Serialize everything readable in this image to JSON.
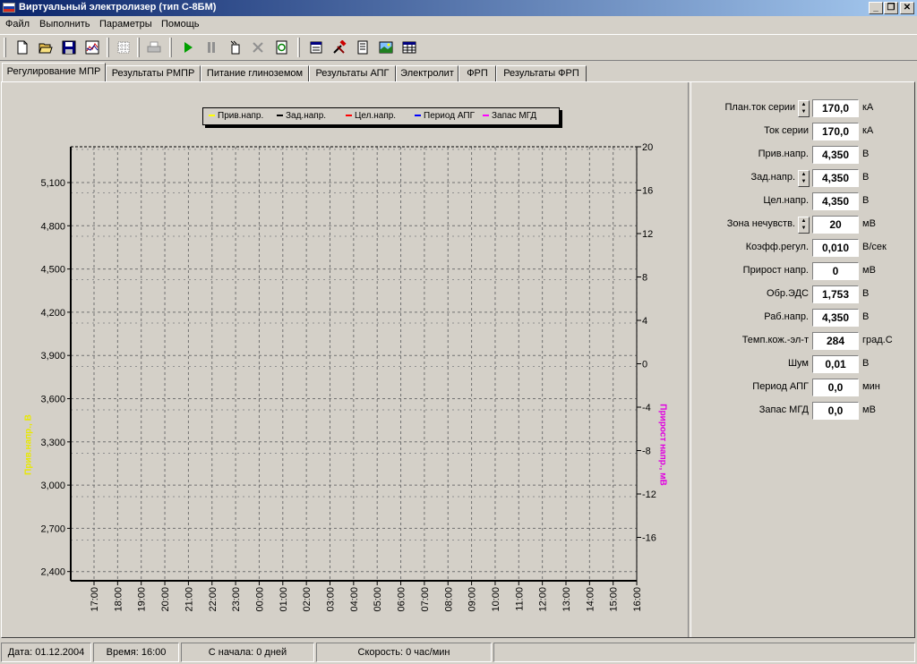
{
  "window": {
    "title": "Виртуальный электролизер (тип С-8БМ)",
    "controls": [
      "_",
      "❐",
      "✕"
    ]
  },
  "menu": [
    "Файл",
    "Выполнить",
    "Параметры",
    "Помощь"
  ],
  "toolbar": {
    "buttons": [
      "new-icon",
      "open-icon",
      "save-icon",
      "chart-icon",
      "grid-icon",
      "print-icon",
      "play-icon",
      "pause-icon",
      "step-icon",
      "stop-icon",
      "refresh-icon",
      "calc-icon",
      "tools-icon",
      "document-icon",
      "image-icon",
      "table-icon"
    ]
  },
  "tabs": [
    "Регулирование МПР",
    "Результаты РМПР",
    "Питание глиноземом",
    "Результаты АПГ",
    "Электролит",
    "ФРП",
    "Результаты ФРП"
  ],
  "chart_data": {
    "type": "line",
    "legend": [
      {
        "name": "Прив.напр.",
        "color": "#ffff00"
      },
      {
        "name": "Зад.напр.",
        "color": "#000000"
      },
      {
        "name": "Цел.напр.",
        "color": "#ff0000"
      },
      {
        "name": "Период АПГ",
        "color": "#0000ff"
      },
      {
        "name": "Запас МГД",
        "color": "#ff00ff"
      }
    ],
    "legend_position": "top",
    "ylabel_left": "Прив.напр., В",
    "ylabel_right": "Прирост напр., мВ",
    "yticks_left": [
      "5,100",
      "4,800",
      "4,500",
      "4,200",
      "3,900",
      "3,600",
      "3,300",
      "3,000",
      "2,700",
      "2,400"
    ],
    "yticks_right": [
      "20",
      "16",
      "12",
      "8",
      "4",
      "0",
      "-4",
      "-8",
      "-12",
      "-16"
    ],
    "xticks": [
      "17:00",
      "18:00",
      "19:00",
      "20:00",
      "21:00",
      "22:00",
      "23:00",
      "00:00",
      "01:00",
      "02:00",
      "03:00",
      "04:00",
      "05:00",
      "06:00",
      "07:00",
      "08:00",
      "09:00",
      "10:00",
      "11:00",
      "12:00",
      "13:00",
      "14:00",
      "15:00",
      "16:00"
    ],
    "grid": true,
    "series": []
  },
  "params": [
    {
      "label": "План.ток серии",
      "value": "170,0",
      "unit": "кА",
      "spin": true
    },
    {
      "label": "Ток серии",
      "value": "170,0",
      "unit": "кА",
      "spin": false
    },
    {
      "label": "Прив.напр.",
      "value": "4,350",
      "unit": "В",
      "spin": false
    },
    {
      "label": "Зад.напр.",
      "value": "4,350",
      "unit": "В",
      "spin": true
    },
    {
      "label": "Цел.напр.",
      "value": "4,350",
      "unit": "В",
      "spin": false
    },
    {
      "label": "Зона нечувств.",
      "value": "20",
      "unit": "мВ",
      "spin": true
    },
    {
      "label": "Коэфф.регул.",
      "value": "0,010",
      "unit": "В/сек",
      "spin": false
    },
    {
      "label": "Прирост напр.",
      "value": "0",
      "unit": "мВ",
      "spin": false
    },
    {
      "label": "Обр.ЭДС",
      "value": "1,753",
      "unit": "В",
      "spin": false
    },
    {
      "label": "Раб.напр.",
      "value": "4,350",
      "unit": "В",
      "spin": false
    },
    {
      "label": "Темп.кож.-эл-т",
      "value": "284",
      "unit": "град.С",
      "spin": false
    },
    {
      "label": "Шум",
      "value": "0,01",
      "unit": "В",
      "spin": false
    },
    {
      "label": "Период АПГ",
      "value": "0,0",
      "unit": "мин",
      "spin": false
    },
    {
      "label": "Запас МГД",
      "value": "0,0",
      "unit": "мВ",
      "spin": false
    }
  ],
  "status": {
    "date": "Дата: 01.12.2004",
    "time": "Время: 16:00",
    "elapsed": "С начала: 0 дней",
    "speed": "Скорость: 0 час/мин"
  }
}
